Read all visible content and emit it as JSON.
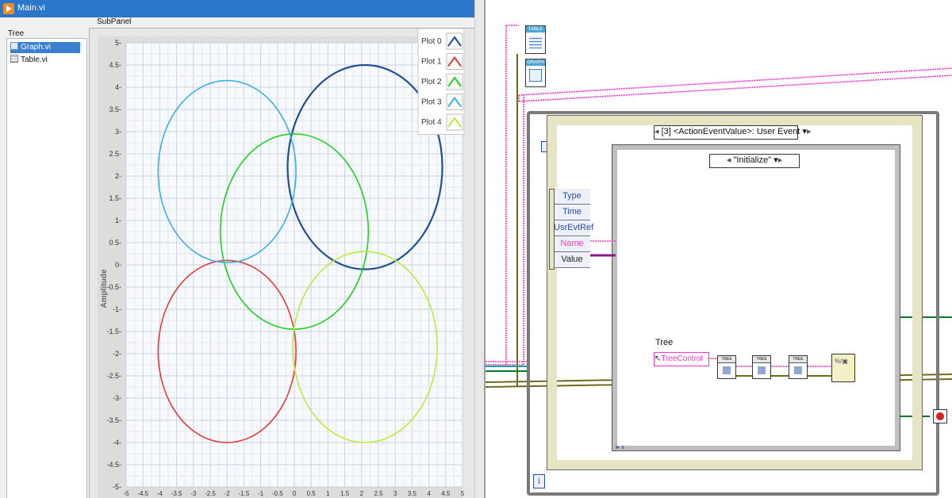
{
  "window": {
    "title": "Main.vi"
  },
  "tree": {
    "label": "Tree",
    "items": [
      {
        "label": "Graph.vi",
        "icon": "graph-vi-icon",
        "selected": true
      },
      {
        "label": "Table.vi",
        "icon": "table-vi-icon",
        "selected": false
      }
    ]
  },
  "subpanel": {
    "label": "SubPanel"
  },
  "chart_data": {
    "type": "line",
    "title": "",
    "xlabel": "",
    "ylabel": "Amplitude",
    "xlim": [
      -5,
      5
    ],
    "ylim": [
      -5,
      5
    ],
    "x_ticks": [
      -5,
      -4.5,
      -4,
      -3.5,
      -3,
      -2.5,
      -2,
      -1.5,
      -1,
      -0.5,
      0,
      0.5,
      1,
      1.5,
      2,
      2.5,
      3,
      3.5,
      4,
      4.5,
      5
    ],
    "y_ticks": [
      5,
      4.5,
      4,
      3.5,
      3,
      2.5,
      2,
      1.5,
      1,
      0.5,
      0,
      -0.5,
      -1,
      -1.5,
      -2,
      -2.5,
      -3,
      -3.5,
      -4,
      -4.5,
      -5
    ],
    "y_tick_labels": [
      "5",
      "4.5",
      "4",
      "3.5",
      "3",
      "2.5",
      "2",
      "1.5",
      "1",
      "0.5",
      "0",
      "-0.5",
      "-1",
      "-1.5",
      "-2",
      "-2.5",
      "-3",
      "-3.5",
      "-4",
      "-4.5",
      "-5"
    ],
    "grid": true,
    "legend_position": "top-right",
    "series": [
      {
        "name": "Plot 0",
        "color": "#1f4f93",
        "shape": "circle",
        "center": [
          2.1,
          2.2
        ],
        "radius": 2.3
      },
      {
        "name": "Plot 1",
        "color": "#e23b3b",
        "shape": "circle",
        "center": [
          -2.0,
          -1.95
        ],
        "radius": 2.05
      },
      {
        "name": "Plot 2",
        "color": "#1fd11f",
        "shape": "circle",
        "center": [
          0.0,
          0.75
        ],
        "radius": 2.2
      },
      {
        "name": "Plot 3",
        "color": "#3aaeee",
        "shape": "circle",
        "center": [
          -2.0,
          2.1
        ],
        "radius": 2.05
      },
      {
        "name": "Plot 4",
        "color": "#b8ee3a",
        "shape": "circle",
        "center": [
          2.1,
          -1.85
        ],
        "radius": 2.15
      }
    ]
  },
  "block_diagram": {
    "table_node": "TABLE",
    "graph_node": "GRAPH",
    "event_selector": "[3] <ActionEventValue>: User Event",
    "case_selector": "\"Initialize\"",
    "event_data": [
      "Type",
      "Time",
      "UsrEvtRef",
      "Name",
      "Value"
    ],
    "tree_label": "Tree",
    "tree_control": "TreeControl",
    "subvi_labels": [
      "TREE",
      "TREE",
      "TREE"
    ],
    "info_terminal": "i",
    "loop_index": "i",
    "colors": {
      "wire_pink": "#ff33cc",
      "wire_olive": "#6e6a1a",
      "wire_green": "#0a7a2e",
      "frame_gray": "#777777"
    }
  }
}
